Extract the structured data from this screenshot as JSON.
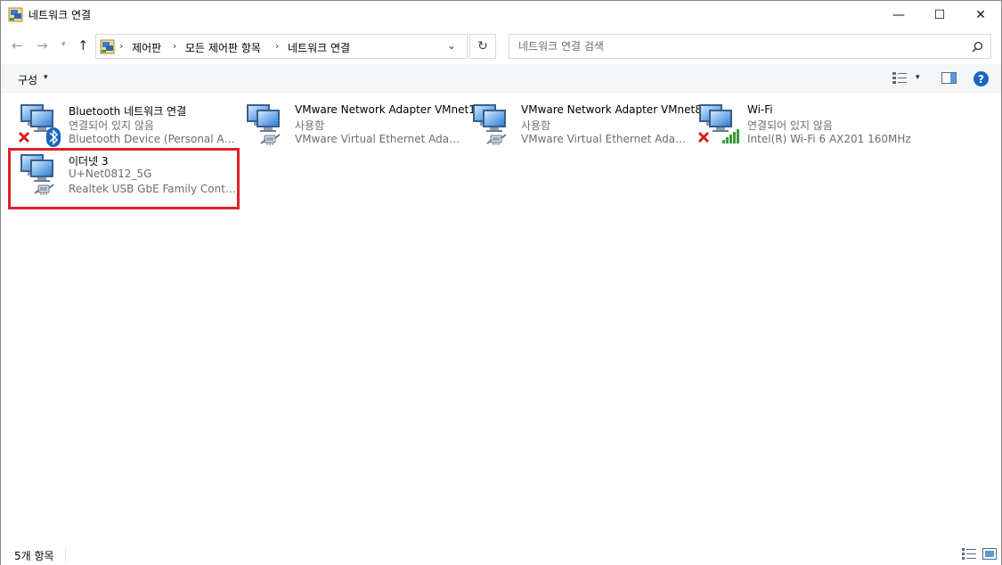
{
  "window": {
    "title": "네트워크 연결",
    "minimize": "—",
    "maximize": "☐",
    "close": "✕"
  },
  "nav": {
    "back": "←",
    "forward": "→",
    "recent": "⌄",
    "up": "↑",
    "breadcrumbs": [
      "제어판",
      "모든 제어판 항목",
      "네트워크 연결"
    ],
    "separator": "›",
    "dropdown": "⌄",
    "refresh": "↻"
  },
  "search": {
    "placeholder": "네트워크 연결 검색"
  },
  "toolbar": {
    "organize": "구성",
    "caret": "▾",
    "help": "?"
  },
  "items": [
    {
      "name": "Bluetooth 네트워크 연결",
      "status": "연결되어 있지 않음",
      "device": "Bluetooth Device (Personal Area ...",
      "icon": "network-adapter-icon",
      "overlay": "bluetooth-disconnected"
    },
    {
      "name": "VMware Network Adapter VMnet1",
      "status": "사용함",
      "device": "VMware Virtual Ethernet Adapter...",
      "icon": "network-adapter-icon",
      "overlay": "ethernet-cable"
    },
    {
      "name": "VMware Network Adapter VMnet8",
      "status": "사용함",
      "device": "VMware Virtual Ethernet Adapter...",
      "icon": "network-adapter-icon",
      "overlay": "ethernet-cable"
    },
    {
      "name": "Wi-Fi",
      "status": "연결되어 있지 않음",
      "device": "Intel(R) Wi-Fi 6 AX201 160MHz",
      "icon": "network-adapter-icon",
      "overlay": "wifi-disconnected"
    },
    {
      "name": "이더넷 3",
      "status": "U+Net0812_5G",
      "device": "Realtek USB GbE Family Controll...",
      "icon": "network-adapter-icon",
      "overlay": "ethernet-cable"
    }
  ],
  "statusbar": {
    "count": "5개 항목"
  },
  "colors": {
    "highlight": "#e0202c",
    "disconnected": "#d81e1e",
    "signal": "#3b9b3b",
    "bluetooth": "#1a66c2",
    "help": "#1a66c2"
  }
}
